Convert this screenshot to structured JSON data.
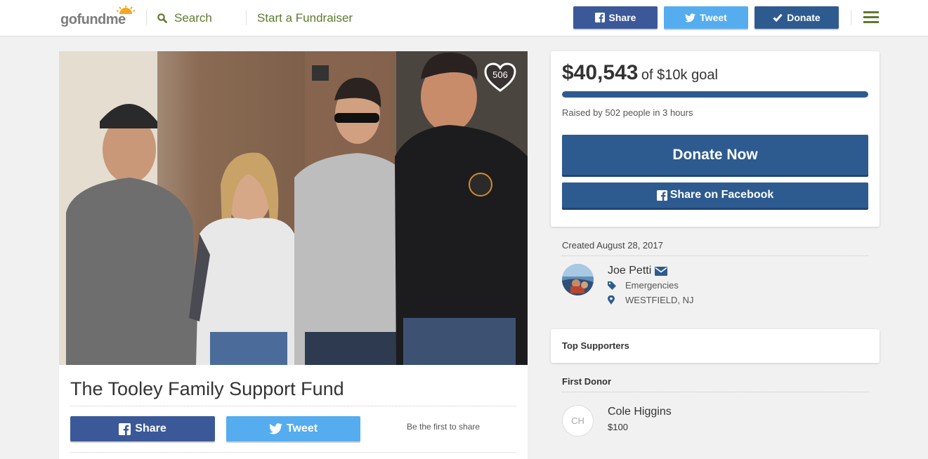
{
  "header": {
    "logo": {
      "go": "go",
      "fund": "fund",
      "me": "me"
    },
    "search_label": "Search",
    "start_label": "Start a Fundraiser",
    "share_label": "Share",
    "tweet_label": "Tweet",
    "donate_label": "Donate"
  },
  "campaign": {
    "hearts": "506",
    "title": "The Tooley Family Support Fund",
    "share_label": "Share",
    "tweet_label": "Tweet",
    "first_share_text": "Be the first to share"
  },
  "donation": {
    "raised": "$40,543",
    "goal_text": "of $10k goal",
    "progress_percent": 100,
    "raised_by": "Raised by 502 people in 3 hours",
    "donate_now_label": "Donate Now",
    "share_fb_label": "Share on Facebook"
  },
  "organizer": {
    "created": "Created August 28, 2017",
    "name": "Joe Petti",
    "category": "Emergencies",
    "location": "WESTFIELD, NJ"
  },
  "supporters": {
    "top_label": "Top Supporters",
    "first_donor_label": "First Donor",
    "donor_initials": "CH",
    "donor_name": "Cole Higgins",
    "donor_amount": "$100"
  },
  "colors": {
    "facebook": "#3b5998",
    "twitter": "#55acee",
    "donate_blue": "#2e5b8f",
    "gofundme_green": "#5c7a2f"
  }
}
